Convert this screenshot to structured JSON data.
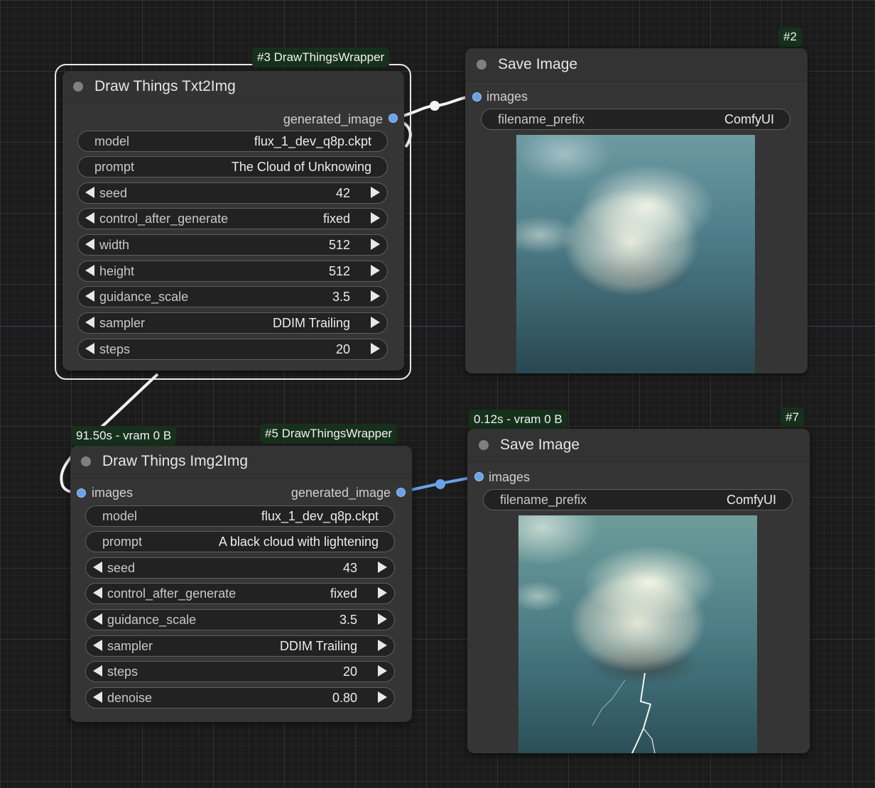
{
  "canvas": {
    "links_color_white": "#f4f4f4",
    "links_color_blue": "#6aa2e8"
  },
  "nodes": {
    "txt2img": {
      "id_badge": "#3 DrawThingsWrapper",
      "title": "Draw Things Txt2Img",
      "output_label": "generated_image",
      "widgets": {
        "model": {
          "label": "model",
          "value": "flux_1_dev_q8p.ckpt"
        },
        "prompt": {
          "label": "prompt",
          "value": "The Cloud of Unknowing"
        },
        "seed": {
          "label": "seed",
          "value": "42"
        },
        "control": {
          "label": "control_after_generate",
          "value": "fixed"
        },
        "width": {
          "label": "width",
          "value": "512"
        },
        "height": {
          "label": "height",
          "value": "512"
        },
        "guidance": {
          "label": "guidance_scale",
          "value": "3.5"
        },
        "sampler": {
          "label": "sampler",
          "value": "DDIM Trailing"
        },
        "steps": {
          "label": "steps",
          "value": "20"
        }
      }
    },
    "save1": {
      "id_badge": "#2",
      "title": "Save Image",
      "input_label": "images",
      "filename_prefix": {
        "label": "filename_prefix",
        "value": "ComfyUI"
      }
    },
    "img2img": {
      "id_badge": "#5 DrawThingsWrapper",
      "timing_badge": "91.50s - vram 0 B",
      "title": "Draw Things Img2Img",
      "input_label": "images",
      "output_label": "generated_image",
      "widgets": {
        "model": {
          "label": "model",
          "value": "flux_1_dev_q8p.ckpt"
        },
        "prompt": {
          "label": "prompt",
          "value": "A black cloud with lightening"
        },
        "seed": {
          "label": "seed",
          "value": "43"
        },
        "control": {
          "label": "control_after_generate",
          "value": "fixed"
        },
        "guidance": {
          "label": "guidance_scale",
          "value": "3.5"
        },
        "sampler": {
          "label": "sampler",
          "value": "DDIM Trailing"
        },
        "steps": {
          "label": "steps",
          "value": "20"
        },
        "denoise": {
          "label": "denoise",
          "value": "0.80"
        }
      }
    },
    "save2": {
      "id_badge": "#7",
      "timing_badge": "0.12s - vram 0 B",
      "title": "Save Image",
      "input_label": "images",
      "filename_prefix": {
        "label": "filename_prefix",
        "value": "ComfyUI"
      }
    }
  }
}
